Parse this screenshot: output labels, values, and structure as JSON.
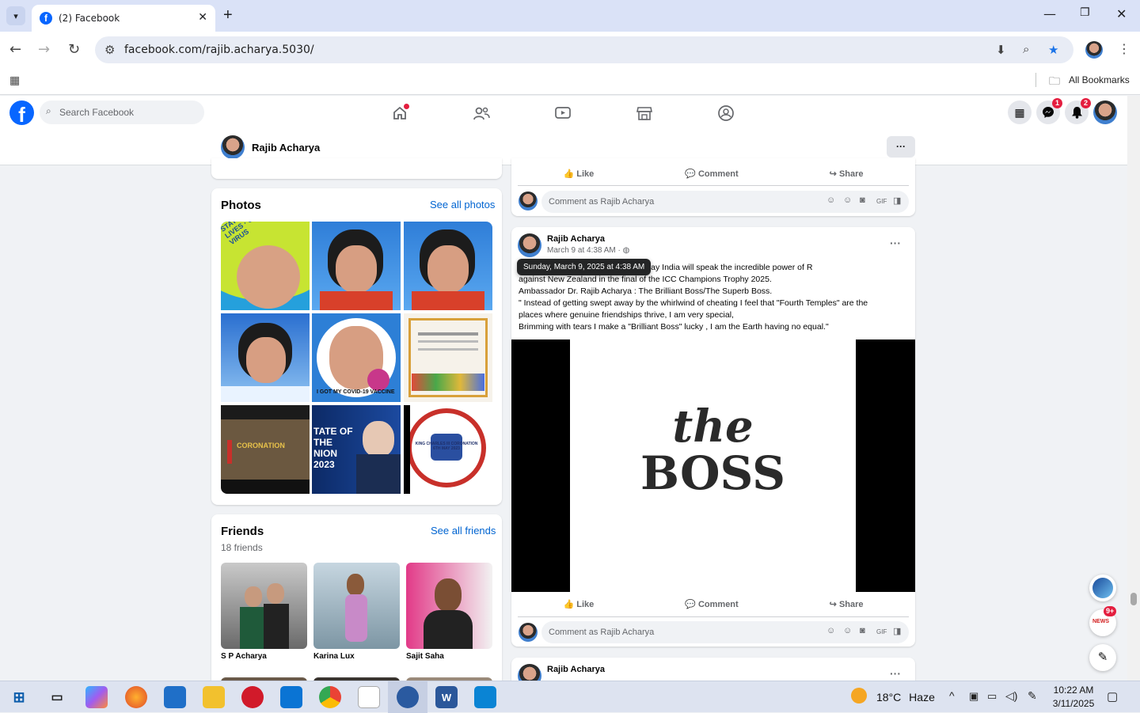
{
  "browser": {
    "tab_title": "(2) Facebook",
    "url": "facebook.com/rajib.acharya.5030/",
    "bookmarks_label": "All Bookmarks"
  },
  "fb": {
    "logo": "f",
    "search_placeholder": "Search Facebook",
    "messenger_badge": "1",
    "notifications_badge": "2"
  },
  "profile": {
    "name": "Rajib Acharya",
    "more": "···"
  },
  "photos": {
    "title": "Photos",
    "see_all": "See all photos",
    "tiles": [
      {
        "name": "photo-stay-alert",
        "text": "STAY ALERT · SAVE LIVES · CONTROL THE VIRUS"
      },
      {
        "name": "photo-portrait-1",
        "text": ""
      },
      {
        "name": "photo-portrait-2",
        "text": ""
      },
      {
        "name": "photo-portrait-clouds",
        "text": ""
      },
      {
        "name": "photo-covid-vaccine",
        "text": "I GOT MY COVID-19 VACCINE"
      },
      {
        "name": "photo-certificate",
        "text": ""
      },
      {
        "name": "photo-coronation",
        "text": "CORONATION"
      },
      {
        "name": "photo-state-of-union",
        "text": "TATE OF THE NION 2023"
      },
      {
        "name": "photo-king-charles",
        "text": "KING CHARLES III CORONATION 6TH MAY 2023"
      }
    ]
  },
  "friends": {
    "title": "Friends",
    "count": "18 friends",
    "see_all": "See all friends",
    "list": [
      {
        "name": "S P Acharya"
      },
      {
        "name": "Karina Lux"
      },
      {
        "name": "Sajit Saha"
      }
    ]
  },
  "post_actions": {
    "like": "Like",
    "comment": "Comment",
    "share": "Share",
    "comment_placeholder": "Comment as Rajib Acharya"
  },
  "post": {
    "author": "Rajib Acharya",
    "time": "March 9 at 4:38 AM",
    "privacy_icon": "globe-icon",
    "tooltip": "Sunday, March 9, 2025 at 4:38 AM",
    "text_lines": [
      "Today 9th March 2025, Sunday. Today India will speak the incredible power of R",
      "against New Zealand in the final of the ICC Champions Trophy 2025.",
      "Ambassador Dr. Rajib Acharya : The Brilliant  Boss/The Superb Boss.",
      "\" Instead of getting swept away by the whirlwind of cheating I feel that \"Fourth Temples\" are the",
      "places where genuine friendships thrive, I am very special,",
      "Brimming with tears I make a \"Brilliant Boss\" lucky , I am the Earth having no equal.\""
    ],
    "image_line1": "the",
    "image_line2": "BOSS",
    "more": "···"
  },
  "next_post": {
    "author": "Rajib Acharya",
    "more": "···"
  },
  "floating": {
    "chat_badge": "9+",
    "news_label": "NEWS"
  },
  "taskbar": {
    "weather_temp": "18°C",
    "weather_desc": "Haze",
    "time": "10:22 AM",
    "date": "3/11/2025"
  }
}
